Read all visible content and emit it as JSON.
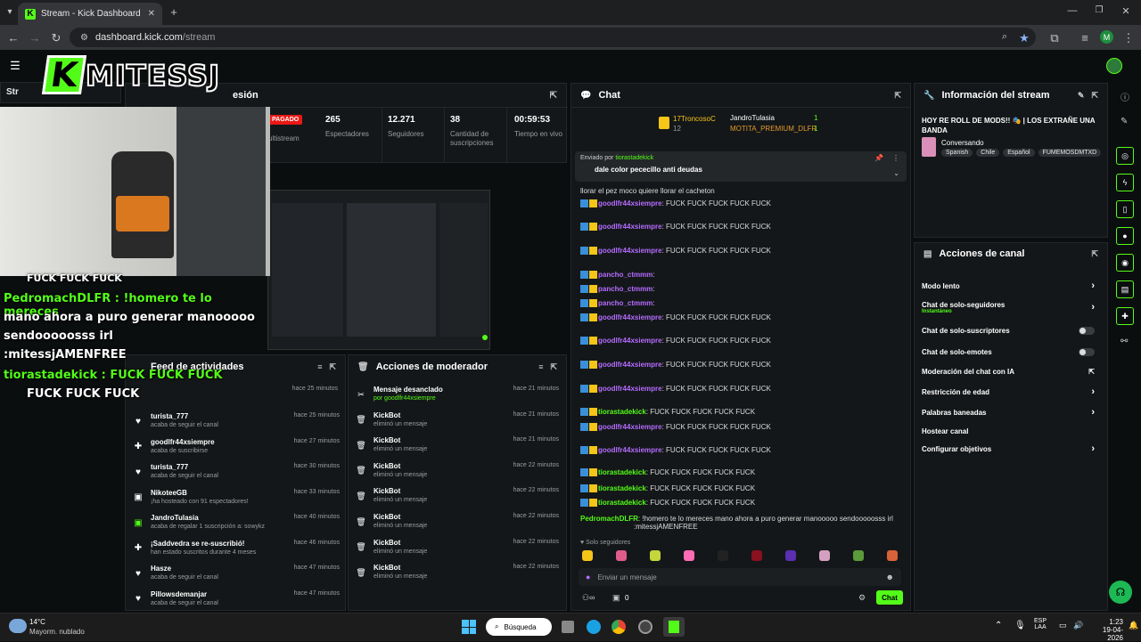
{
  "browser": {
    "tab_title": "Stream - Kick Dashboard",
    "url_host": "dashboard.kick.com",
    "url_path": "/stream",
    "profile_initial": "M"
  },
  "overlay": {
    "logo_text": "MITESSJ",
    "logo_k": "K",
    "lines": [
      "PedromachDLFR : !homero te lo mereces",
      "mano ahora a puro generar manooooo",
      "sendooooosss irl",
      ":mitessjAMENFREE",
      "tiorastadekick : FUCK    FUCK    FUCK",
      "FUCK    FUCK    FUCK"
    ],
    "top_fuck": "FUCK    FUCK    FUCK"
  },
  "session": {
    "title_suffix": "esión",
    "status": "PAGADO",
    "multistream": "ultistream",
    "stats": [
      {
        "value": "265",
        "label": "Espectadores"
      },
      {
        "value": "12.271",
        "label": "Seguidores"
      },
      {
        "value": "38",
        "label": "Cantidad de suscripciones"
      },
      {
        "value": "00:59:53",
        "label": "Tiempo en vivo"
      }
    ],
    "stream_tab": "Str"
  },
  "feed": {
    "title": "Feed de actividades",
    "items": [
      {
        "name": "turista_777",
        "desc": "acaba de seguir el canal",
        "time": "hace 25 minutos"
      },
      {
        "name": "goodlfr44xsiempre",
        "desc": "acaba de suscribirse",
        "time": "hace 27 minutos"
      },
      {
        "name": "turista_777",
        "desc": "acaba de seguir el canal",
        "time": "hace 30 minutos"
      },
      {
        "name": "NikoteeGB",
        "desc": "¡ha hosteado con 91 espectadores!",
        "time": "hace 33 minutos"
      },
      {
        "name": "JandroTulasia",
        "desc": "acaba de regalar 1 suscripción a: sowykz",
        "time": "hace 40 minutos"
      },
      {
        "name": "¡Saddvedra se re-suscribió!",
        "desc": "han estado suscritos durante 4 meses",
        "time": "hace 46 minutos"
      },
      {
        "name": "Hasze",
        "desc": "acaba de seguir el canal",
        "time": "hace 47 minutos"
      },
      {
        "name": "Pillowsdemanjar",
        "desc": "acaba de seguir el canal",
        "time": "hace 47 minutos"
      }
    ],
    "first_time": "hace 25 minutos"
  },
  "mod": {
    "title": "Acciones de moderador",
    "items": [
      {
        "name": "Mensaje desanclado",
        "desc": "por goodlfr44xsiempre",
        "time": "hace 21 minutos"
      },
      {
        "name": "KickBot",
        "desc": "eliminó un mensaje",
        "time": "hace 21 minutos"
      },
      {
        "name": "KickBot",
        "desc": "eliminó un mensaje",
        "time": "hace 21 minutos"
      },
      {
        "name": "KickBot",
        "desc": "eliminó un mensaje",
        "time": "hace 22 minutos"
      },
      {
        "name": "KickBot",
        "desc": "eliminó un mensaje",
        "time": "hace 22 minutos"
      },
      {
        "name": "KickBot",
        "desc": "eliminó un mensaje",
        "time": "hace 22 minutos"
      },
      {
        "name": "KickBot",
        "desc": "eliminó un mensaje",
        "time": "hace 22 minutos"
      },
      {
        "name": "KickBot",
        "desc": "eliminó un mensaje",
        "time": "hace 22 minutos"
      }
    ]
  },
  "chat": {
    "title": "Chat",
    "top_gifters": [
      {
        "name": "17TroncosoC",
        "count": "12"
      },
      {
        "name": "JandroTulasia",
        "count": "1"
      },
      {
        "name": "MOTITA_PREMIUM_DLFR",
        "count": "1"
      }
    ],
    "pinned_by_label": "Enviado por",
    "pinned_user": "tiorastadekick",
    "pinned_text": "dale color pececillo anti deudas",
    "first_line": "llorar el pez moco quiere llorar el cacheton",
    "messages": [
      {
        "user": "goodlfr44xsiempre",
        "text": ": FUCK    FUCK    FUCK    FUCK    FUCK",
        "color": "purple"
      },
      {
        "user": "goodlfr44xsiempre",
        "text": ": FUCK    FUCK    FUCK    FUCK    FUCK",
        "color": "purple"
      },
      {
        "user": "goodlfr44xsiempre",
        "text": ": FUCK    FUCK    FUCK    FUCK    FUCK",
        "color": "purple"
      },
      {
        "user": "pancho_ctmmm",
        "text": ":",
        "color": "purple"
      },
      {
        "user": "pancho_ctmmm",
        "text": ":",
        "color": "purple"
      },
      {
        "user": "pancho_ctmmm",
        "text": ":",
        "color": "purple"
      },
      {
        "user": "goodlfr44xsiempre",
        "text": ": FUCK    FUCK    FUCK    FUCK    FUCK",
        "color": "purple"
      },
      {
        "user": "goodlfr44xsiempre",
        "text": ": FUCK    FUCK    FUCK    FUCK    FUCK",
        "color": "purple"
      },
      {
        "user": "goodlfr44xsiempre",
        "text": ": FUCK    FUCK    FUCK    FUCK    FUCK",
        "color": "purple"
      },
      {
        "user": "goodlfr44xsiempre",
        "text": ": FUCK    FUCK    FUCK    FUCK    FUCK",
        "color": "purple"
      },
      {
        "user": "tiorastadekick",
        "text": ": FUCK    FUCK    FUCK    FUCK    FUCK",
        "color": "green"
      },
      {
        "user": "goodlfr44xsiempre",
        "text": ": FUCK    FUCK    FUCK    FUCK    FUCK",
        "color": "purple"
      },
      {
        "user": "goodlfr44xsiempre",
        "text": ": FUCK    FUCK    FUCK    FUCK    FUCK",
        "color": "purple"
      },
      {
        "user": "tiorastadekick",
        "text": ": FUCK    FUCK    FUCK    FUCK    FUCK",
        "color": "green"
      },
      {
        "user": "tiorastadekick",
        "text": ": FUCK    FUCK    FUCK    FUCK    FUCK",
        "color": "green"
      },
      {
        "user": "tiorastadekick",
        "text": ": FUCK    FUCK    FUCK    FUCK    FUCK",
        "color": "green"
      }
    ],
    "last_user": "PedromachDLFR",
    "last_text": ": !homero te lo mereces mano ahora a puro generar manooooo sendooooosss irl",
    "last_text2": ":mitessjAMENFREE",
    "followers_only": "Solo seguidores",
    "input_placeholder": "Enviar un mensaje",
    "zero": "0",
    "send_label": "Chat"
  },
  "info": {
    "title": "Información del stream",
    "stream_title": "HOY RE ROLL DE MODS!! 🎭 | LOS EXTRAÑE UNA BANDA",
    "category": "Conversando",
    "tags": [
      "Spanish",
      "Chile",
      "Español",
      "FUMEMOSDMTXD"
    ]
  },
  "actions": {
    "title": "Acciones de canal",
    "rows": [
      {
        "label": "Modo lento",
        "kind": "chevron",
        "sub": ""
      },
      {
        "label": "Chat de solo-seguidores",
        "kind": "chevron",
        "sub": "Instantáneo"
      },
      {
        "label": "Chat de solo-suscriptores",
        "kind": "toggle",
        "sub": ""
      },
      {
        "label": "Chat de solo-emotes",
        "kind": "toggle",
        "sub": ""
      },
      {
        "label": "Moderación del chat con IA",
        "kind": "ext",
        "sub": ""
      },
      {
        "label": "Restricción de edad",
        "kind": "chevron",
        "sub": ""
      },
      {
        "label": "Palabras baneadas",
        "kind": "chevron",
        "sub": ""
      },
      {
        "label": "Hostear canal",
        "kind": "none",
        "sub": ""
      },
      {
        "label": "Configurar objetivos",
        "kind": "chevron",
        "sub": ""
      }
    ]
  },
  "taskbar": {
    "temp": "14°C",
    "weather": "Mayorm. nublado",
    "search": "Búsqueda",
    "lang1": "ESP",
    "lang2": "LAA",
    "time": "1:23",
    "date": "19-04-2026"
  }
}
